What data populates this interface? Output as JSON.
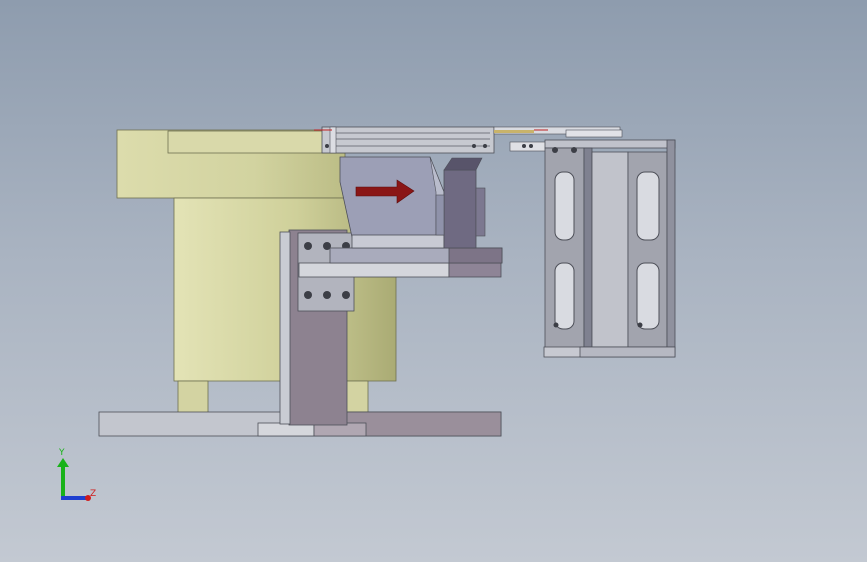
{
  "viewport": {
    "background_top": "#8e9cae",
    "background_bottom": "#c3c9d2"
  },
  "model": {
    "feed_direction_icon": "arrow-right-icon",
    "arrow_color": "#8a1616"
  },
  "triad": {
    "y_label": "Y",
    "z_label": "Z",
    "colors": {
      "x": "#1e3fd0",
      "y": "#19b219",
      "z": "#d01b1b"
    }
  }
}
